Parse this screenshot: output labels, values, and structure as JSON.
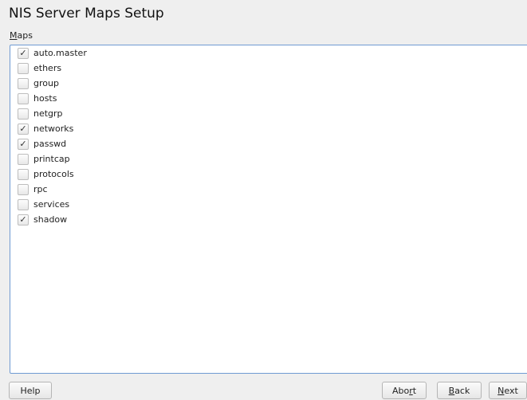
{
  "window": {
    "title": "NIS Server Maps Setup"
  },
  "maps": {
    "label_mnemonic": "M",
    "label_rest": "aps",
    "items": [
      {
        "label": "auto.master",
        "checked": true
      },
      {
        "label": "ethers",
        "checked": false
      },
      {
        "label": "group",
        "checked": false
      },
      {
        "label": "hosts",
        "checked": false
      },
      {
        "label": "netgrp",
        "checked": false
      },
      {
        "label": "networks",
        "checked": true
      },
      {
        "label": "passwd",
        "checked": true
      },
      {
        "label": "printcap",
        "checked": false
      },
      {
        "label": "protocols",
        "checked": false
      },
      {
        "label": "rpc",
        "checked": false
      },
      {
        "label": "services",
        "checked": false
      },
      {
        "label": "shadow",
        "checked": true
      }
    ]
  },
  "buttons": {
    "help": "Help",
    "abort_pre": "Abo",
    "abort_mnemonic": "r",
    "abort_post": "t",
    "back_mnemonic": "B",
    "back_post": "ack",
    "next_mnemonic": "N",
    "next_post": "ext"
  },
  "icons": {
    "check": "checkmark-icon"
  },
  "colors": {
    "list_border": "#6f9ad2",
    "background": "#efefef"
  }
}
